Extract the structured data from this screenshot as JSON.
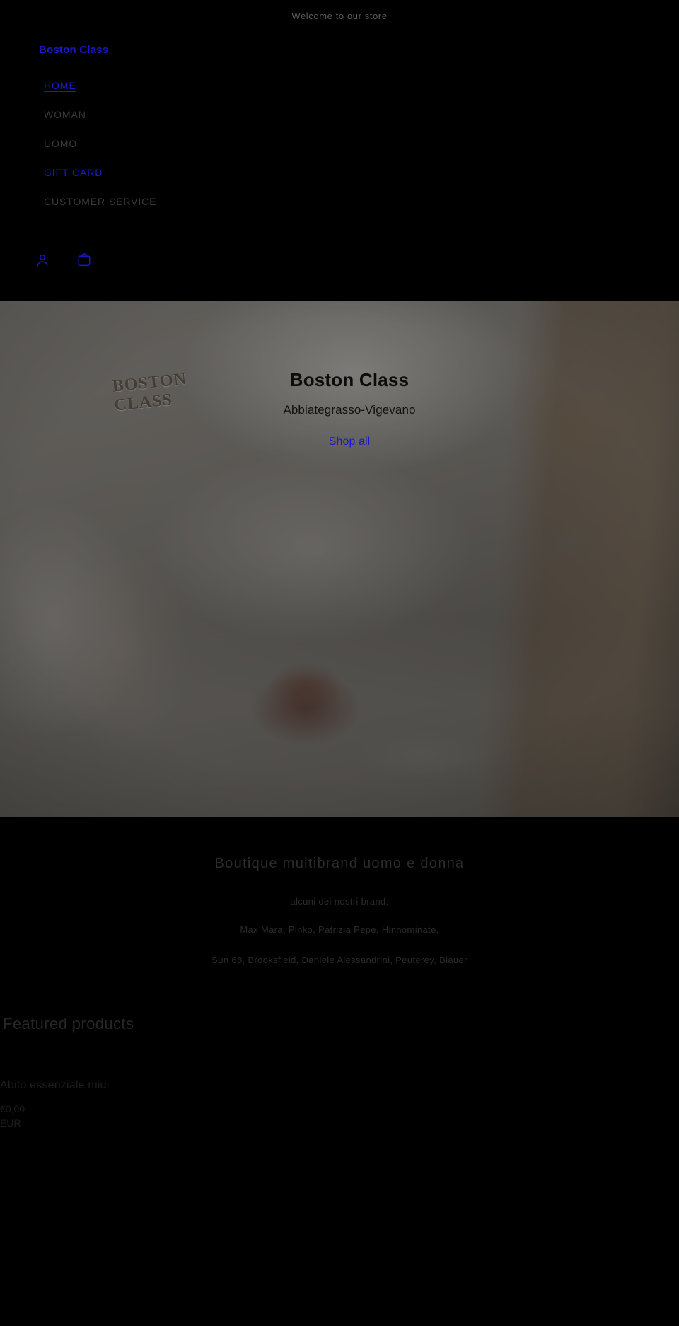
{
  "announcement": {
    "text": "Welcome to our store"
  },
  "header": {
    "brand": "Boston Class",
    "nav": [
      {
        "label": "HOME",
        "state": "active"
      },
      {
        "label": "WOMAN",
        "state": "default"
      },
      {
        "label": "UOMO",
        "state": "default"
      },
      {
        "label": "GIFT CARD",
        "state": "accent"
      },
      {
        "label": "CUSTOMER SERVICE",
        "state": "default"
      }
    ],
    "actions": [
      {
        "name": "account-icon",
        "label": "Account"
      },
      {
        "name": "cart-icon",
        "label": "Cart"
      }
    ],
    "accent_color": "#1a19c9"
  },
  "hero": {
    "logo_mark": "BOSTON CLASS",
    "title": "Boston Class",
    "subtitle": "Abbiategrasso-Vigevano",
    "cta_label": "Shop all"
  },
  "richtext": {
    "heading": "Boutique multibrand uomo e donna",
    "lead": "alcuni dei nostri brand:",
    "line1": "Max Mara, Pinko, Patrizia Pepe, Hinnominate,",
    "line2": "Sun 68, Brooksfield, Daniele Alessandrini, Peuterey, Blauer"
  },
  "featured": {
    "title": "Featured products",
    "products": [
      {
        "title": "Abito essenziale midi",
        "price_amount": "€0,00",
        "price_currency": "EUR"
      }
    ]
  }
}
